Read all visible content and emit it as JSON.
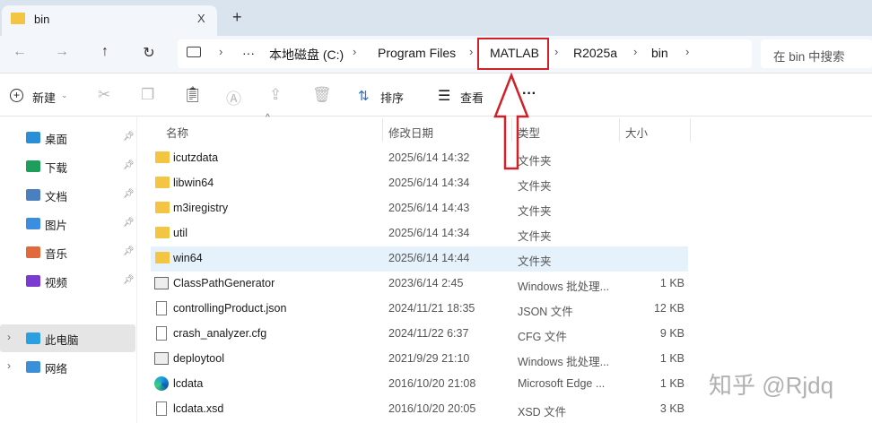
{
  "tab": {
    "title": "bin",
    "close": "X",
    "new": "+"
  },
  "nav": {
    "back": "←",
    "forward": "→",
    "up": "↑",
    "refresh": "↻"
  },
  "breadcrumb": {
    "more": "···",
    "items": [
      "本地磁盘 (C:)",
      "Program Files",
      "MATLAB",
      "R2025a",
      "bin"
    ]
  },
  "search": {
    "placeholder": "在 bin 中搜索"
  },
  "toolbar": {
    "new": "新建",
    "sort": "排序",
    "view": "查看",
    "more": "···"
  },
  "sidebar": {
    "pinned": [
      {
        "label": "桌面",
        "color": "#2b8fd8"
      },
      {
        "label": "下载",
        "color": "#1d9e5a"
      },
      {
        "label": "文档",
        "color": "#4a7fc0"
      },
      {
        "label": "图片",
        "color": "#3b8de0"
      },
      {
        "label": "音乐",
        "color": "#e06a3b"
      },
      {
        "label": "视频",
        "color": "#7a3bd0"
      }
    ],
    "tree": [
      {
        "label": "此电脑",
        "selected": true
      },
      {
        "label": "网络",
        "selected": false
      }
    ]
  },
  "columns": {
    "name": "名称",
    "date": "修改日期",
    "type": "类型",
    "size": "大小"
  },
  "files": [
    {
      "name": "icutzdata",
      "date": "2025/6/14 14:32",
      "type": "文件夹",
      "size": "",
      "icon": "folder"
    },
    {
      "name": "libwin64",
      "date": "2025/6/14 14:34",
      "type": "文件夹",
      "size": "",
      "icon": "folder"
    },
    {
      "name": "m3iregistry",
      "date": "2025/6/14 14:43",
      "type": "文件夹",
      "size": "",
      "icon": "folder"
    },
    {
      "name": "util",
      "date": "2025/6/14 14:34",
      "type": "文件夹",
      "size": "",
      "icon": "folder"
    },
    {
      "name": "win64",
      "date": "2025/6/14 14:44",
      "type": "文件夹",
      "size": "",
      "icon": "folder",
      "selected": true
    },
    {
      "name": "ClassPathGenerator",
      "date": "2023/6/14 2:45",
      "type": "Windows 批处理...",
      "size": "1 KB",
      "icon": "batch"
    },
    {
      "name": "controllingProduct.json",
      "date": "2024/11/21 18:35",
      "type": "JSON 文件",
      "size": "12 KB",
      "icon": "file"
    },
    {
      "name": "crash_analyzer.cfg",
      "date": "2024/11/22 6:37",
      "type": "CFG 文件",
      "size": "9 KB",
      "icon": "file"
    },
    {
      "name": "deploytool",
      "date": "2021/9/29 21:10",
      "type": "Windows 批处理...",
      "size": "1 KB",
      "icon": "batch"
    },
    {
      "name": "lcdata",
      "date": "2016/10/20 21:08",
      "type": "Microsoft Edge ...",
      "size": "1 KB",
      "icon": "edge"
    },
    {
      "name": "lcdata.xsd",
      "date": "2016/10/20 20:05",
      "type": "XSD 文件",
      "size": "3 KB",
      "icon": "file"
    }
  ],
  "watermark": "知乎 @Rjdq",
  "annotation_color": "#d0202a"
}
